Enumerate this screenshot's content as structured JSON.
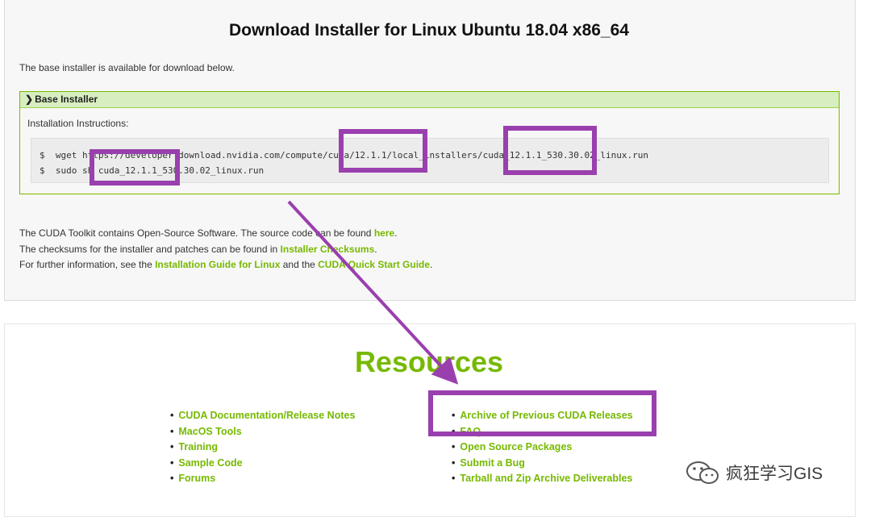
{
  "header": {
    "title": "Download Installer for Linux Ubuntu 18.04 x86_64"
  },
  "intro": "The base installer is available for download below.",
  "installer": {
    "section_label": "Base Installer",
    "instructions_label": "Installation Instructions:",
    "command_1": "$  wget https://developer.download.nvidia.com/compute/cuda/12.1.1/local_installers/cuda_12.1.1_530.30.02_linux.run",
    "command_2": "$  sudo sh cuda_12.1.1_530.30.02_linux.run"
  },
  "info": {
    "line1_prefix": "The CUDA Toolkit contains Open-Source Software. The source code can be found ",
    "line1_link": "here",
    "line1_suffix": ".",
    "line2_prefix": "The checksums for the installer and patches can be found in ",
    "line2_link": "Installer Checksums",
    "line2_suffix": ".",
    "line3_prefix": "For further information, see the ",
    "line3_link1": "Installation Guide for Linux",
    "line3_mid": " and the ",
    "line3_link2": "CUDA Quick Start Guide",
    "line3_suffix": "."
  },
  "resources": {
    "title": "Resources",
    "left": [
      "CUDA Documentation/Release Notes",
      "MacOS Tools",
      "Training",
      "Sample Code",
      "Forums"
    ],
    "right": [
      "Archive of Previous CUDA Releases",
      "FAQ",
      "Open Source Packages",
      "Submit a Bug",
      "Tarball and Zip Archive Deliverables"
    ]
  },
  "watermark": {
    "text": "疯狂学习GIS",
    "icon": "wechat-icon"
  },
  "colors": {
    "accent": "#76b900",
    "highlight": "#9a3fae"
  }
}
